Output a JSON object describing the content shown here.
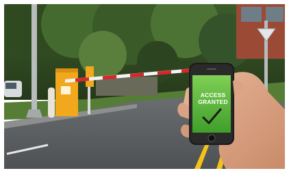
{
  "phone": {
    "line1": "ACCESS",
    "line2": "GRANTED",
    "check_icon": "check-mark-icon"
  },
  "colors": {
    "screen_green": "#56bd3c",
    "post_yellow": "#f2a81d",
    "barrier_red": "#d8262b",
    "road_gray": "#5b5e61",
    "line_yellow": "#f5c21a"
  }
}
